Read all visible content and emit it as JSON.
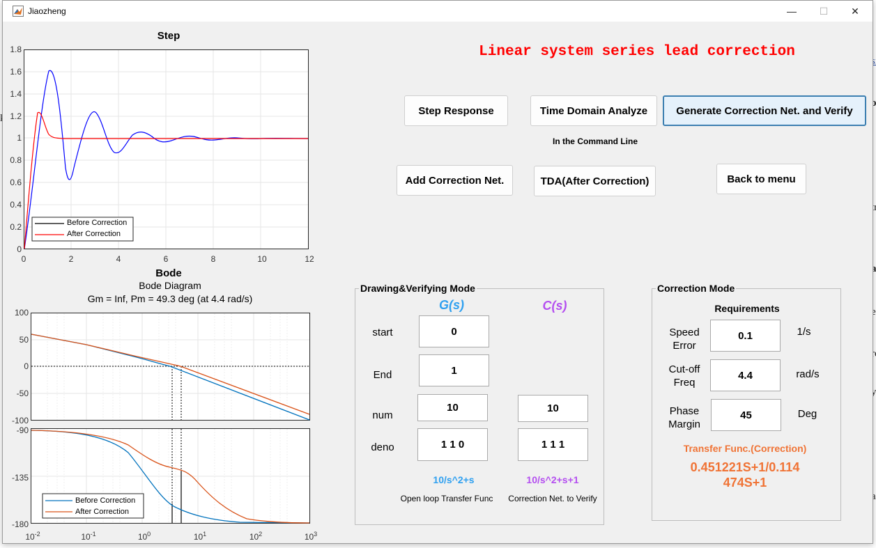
{
  "window": {
    "title": "Jiaozheng",
    "minimize_glyph": "—",
    "maximize_glyph": "☐",
    "close_glyph": "✕"
  },
  "background_fragments": [
    "k",
    "si",
    "o",
    "tr",
    "a",
    "e",
    "re",
    "y",
    "a"
  ],
  "heading": "Linear system series lead correction",
  "buttons": {
    "step_response": "Step Response",
    "time_domain_analyze": "Time Domain Analyze",
    "generate_verify": "Generate Correction Net. and Verify",
    "command_line_note": "In the Command Line",
    "add_correction": "Add Correction Net.",
    "tda_after": "TDA(After Correction)",
    "back_to_menu": "Back to menu"
  },
  "step_plot": {
    "title": "Step",
    "y_ticks": [
      "1.8",
      "1.6",
      "1.4",
      "1.2",
      "1",
      "0.8",
      "0.6",
      "0.4",
      "0.2",
      "0"
    ],
    "x_ticks": [
      "0",
      "2",
      "4",
      "6",
      "8",
      "10",
      "12"
    ],
    "legend": [
      "Before Correction",
      "After Correction"
    ],
    "colors": {
      "before": "#0000ff",
      "after": "#ff0000",
      "legend_before": "#000000"
    }
  },
  "bode_plot": {
    "title": "Bode",
    "subtitle": "Bode Diagram",
    "margins_text": "Gm = Inf,  Pm = 49.3 deg (at 4.4 rad/s)",
    "mag_ticks": [
      "100",
      "50",
      "0",
      "-50",
      "-100"
    ],
    "phase_ticks": [
      "-90",
      "-135",
      "-180"
    ],
    "x_ticks": [
      {
        "base": "10",
        "exp": "-2"
      },
      {
        "base": "10",
        "exp": "-1"
      },
      {
        "base": "10",
        "exp": "0"
      },
      {
        "base": "10",
        "exp": "1"
      },
      {
        "base": "10",
        "exp": "2"
      },
      {
        "base": "10",
        "exp": "3"
      }
    ],
    "legend": [
      "Before Correction",
      "After Correction"
    ],
    "colors": {
      "before": "#0072bd",
      "after": "#d95319"
    }
  },
  "drawing_panel": {
    "title": "Drawing&Verifying Mode",
    "g_head": "G(s)",
    "c_head": "C(s)",
    "start_label": "start",
    "start_value": "0",
    "end_label": "End",
    "end_value": "1",
    "num_label": "num",
    "num_g": "10",
    "num_c": "10",
    "deno_label": "deno",
    "deno_g": "1 1 0",
    "deno_c": "1 1 1",
    "tf_g": "10/s^2+s",
    "tf_c": "10/s^2+s+1",
    "caption_g": "Open loop Transfer Func",
    "caption_c": "Correction Net. to Verify",
    "g_color": "#2fa0f0",
    "c_color": "#b44ef0"
  },
  "correction_panel": {
    "title": "Correction Mode",
    "requirements": "Requirements",
    "speed_label": "Speed Error",
    "speed_value": "0.1",
    "speed_unit": "1/s",
    "cutoff_label": "Cut-off Freq",
    "cutoff_value": "4.4",
    "cutoff_unit": "rad/s",
    "phase_label": "Phase Margin",
    "phase_value": "45",
    "phase_unit": "Deg",
    "result_title": "Transfer Func.(Correction)",
    "result_line1": "0.451221S+1/0.114",
    "result_line2": "474S+1",
    "result_color": "#f07335"
  }
}
